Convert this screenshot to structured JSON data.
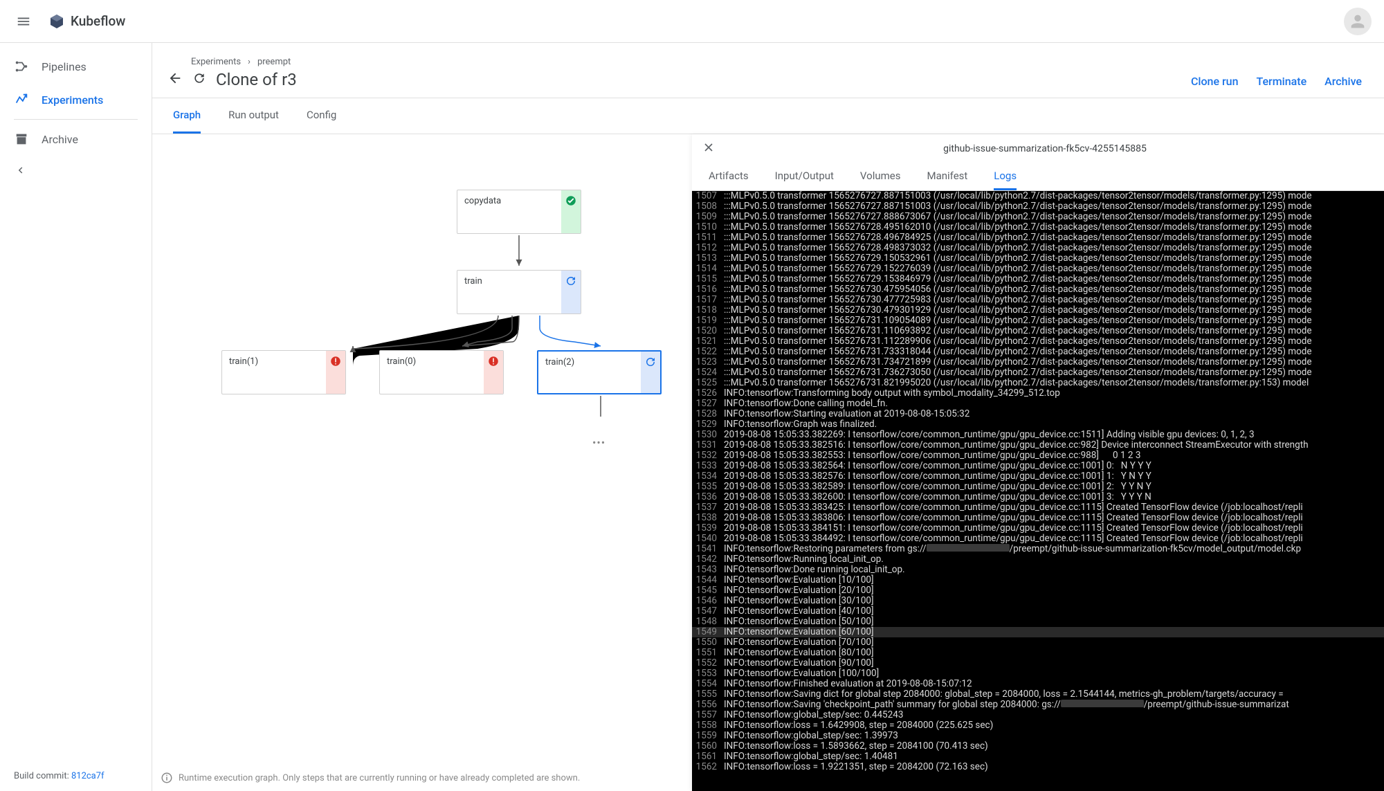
{
  "brand": {
    "name": "Kubeflow"
  },
  "sidebar": {
    "items": [
      {
        "label": "Pipelines"
      },
      {
        "label": "Experiments"
      },
      {
        "label": "Archive"
      }
    ],
    "build_label": "Build commit: ",
    "build_hash": "812ca7f"
  },
  "breadcrumbs": [
    "Experiments",
    "preempt"
  ],
  "page_title": "Clone of r3",
  "head_actions": [
    "Clone run",
    "Terminate",
    "Archive"
  ],
  "tabs": [
    "Graph",
    "Run output",
    "Config"
  ],
  "graph": {
    "nodes": [
      {
        "id": "copydata",
        "label": "copydata",
        "status": "success"
      },
      {
        "id": "train",
        "label": "train",
        "status": "running"
      },
      {
        "id": "train1",
        "label": "train(1)",
        "status": "error"
      },
      {
        "id": "train0",
        "label": "train(0)",
        "status": "error"
      },
      {
        "id": "train2",
        "label": "train(2)",
        "status": "running",
        "selected": true
      }
    ]
  },
  "footer_note": "Runtime execution graph. Only steps that are currently running or have already completed are shown.",
  "side_panel": {
    "title": "github-issue-summarization-fk5cv-4255145885",
    "tabs": [
      "Artifacts",
      "Input/Output",
      "Volumes",
      "Manifest",
      "Logs"
    ],
    "active_tab": "Logs"
  },
  "logs": [
    {
      "n": 1507,
      "t": ":::MLPv0.5.0 transformer 1565276727.887151003 (/usr/local/lib/python2.7/dist-packages/tensor2tensor/models/transformer.py:1295) mode"
    },
    {
      "n": 1508,
      "t": ":::MLPv0.5.0 transformer 1565276727.887151003 (/usr/local/lib/python2.7/dist-packages/tensor2tensor/models/transformer.py:1295) mode"
    },
    {
      "n": 1509,
      "t": ":::MLPv0.5.0 transformer 1565276727.888673067 (/usr/local/lib/python2.7/dist-packages/tensor2tensor/models/transformer.py:1295) mode"
    },
    {
      "n": 1510,
      "t": ":::MLPv0.5.0 transformer 1565276728.495162010 (/usr/local/lib/python2.7/dist-packages/tensor2tensor/models/transformer.py:1295) mode"
    },
    {
      "n": 1511,
      "t": ":::MLPv0.5.0 transformer 1565276728.496784925 (/usr/local/lib/python2.7/dist-packages/tensor2tensor/models/transformer.py:1295) mode"
    },
    {
      "n": 1512,
      "t": ":::MLPv0.5.0 transformer 1565276728.498373032 (/usr/local/lib/python2.7/dist-packages/tensor2tensor/models/transformer.py:1295) mode"
    },
    {
      "n": 1513,
      "t": ":::MLPv0.5.0 transformer 1565276729.150532961 (/usr/local/lib/python2.7/dist-packages/tensor2tensor/models/transformer.py:1295) mode"
    },
    {
      "n": 1514,
      "t": ":::MLPv0.5.0 transformer 1565276729.152276039 (/usr/local/lib/python2.7/dist-packages/tensor2tensor/models/transformer.py:1295) mode"
    },
    {
      "n": 1515,
      "t": ":::MLPv0.5.0 transformer 1565276729.153846979 (/usr/local/lib/python2.7/dist-packages/tensor2tensor/models/transformer.py:1295) mode"
    },
    {
      "n": 1516,
      "t": ":::MLPv0.5.0 transformer 1565276730.475954056 (/usr/local/lib/python2.7/dist-packages/tensor2tensor/models/transformer.py:1295) mode"
    },
    {
      "n": 1517,
      "t": ":::MLPv0.5.0 transformer 1565276730.477725983 (/usr/local/lib/python2.7/dist-packages/tensor2tensor/models/transformer.py:1295) mode"
    },
    {
      "n": 1518,
      "t": ":::MLPv0.5.0 transformer 1565276730.479301929 (/usr/local/lib/python2.7/dist-packages/tensor2tensor/models/transformer.py:1295) mode"
    },
    {
      "n": 1519,
      "t": ":::MLPv0.5.0 transformer 1565276731.109054089 (/usr/local/lib/python2.7/dist-packages/tensor2tensor/models/transformer.py:1295) mode"
    },
    {
      "n": 1520,
      "t": ":::MLPv0.5.0 transformer 1565276731.110693892 (/usr/local/lib/python2.7/dist-packages/tensor2tensor/models/transformer.py:1295) mode"
    },
    {
      "n": 1521,
      "t": ":::MLPv0.5.0 transformer 1565276731.112289906 (/usr/local/lib/python2.7/dist-packages/tensor2tensor/models/transformer.py:1295) mode"
    },
    {
      "n": 1522,
      "t": ":::MLPv0.5.0 transformer 1565276731.733318044 (/usr/local/lib/python2.7/dist-packages/tensor2tensor/models/transformer.py:1295) mode"
    },
    {
      "n": 1523,
      "t": ":::MLPv0.5.0 transformer 1565276731.734721899 (/usr/local/lib/python2.7/dist-packages/tensor2tensor/models/transformer.py:1295) mode"
    },
    {
      "n": 1524,
      "t": ":::MLPv0.5.0 transformer 1565276731.736273050 (/usr/local/lib/python2.7/dist-packages/tensor2tensor/models/transformer.py:1295) mode"
    },
    {
      "n": 1525,
      "t": ":::MLPv0.5.0 transformer 1565276731.821995020 (/usr/local/lib/python2.7/dist-packages/tensor2tensor/models/transformer.py:153) model"
    },
    {
      "n": 1526,
      "t": "INFO:tensorflow:Transforming body output with symbol_modality_34299_512.top"
    },
    {
      "n": 1527,
      "t": "INFO:tensorflow:Done calling model_fn."
    },
    {
      "n": 1528,
      "t": "INFO:tensorflow:Starting evaluation at 2019-08-08-15:05:32"
    },
    {
      "n": 1529,
      "t": "INFO:tensorflow:Graph was finalized."
    },
    {
      "n": 1530,
      "t": "2019-08-08 15:05:33.382269: I tensorflow/core/common_runtime/gpu/gpu_device.cc:1511] Adding visible gpu devices: 0, 1, 2, 3"
    },
    {
      "n": 1531,
      "t": "2019-08-08 15:05:33.382516: I tensorflow/core/common_runtime/gpu/gpu_device.cc:982] Device interconnect StreamExecutor with strength"
    },
    {
      "n": 1532,
      "t": "2019-08-08 15:05:33.382553: I tensorflow/core/common_runtime/gpu/gpu_device.cc:988]      0 1 2 3"
    },
    {
      "n": 1533,
      "t": "2019-08-08 15:05:33.382564: I tensorflow/core/common_runtime/gpu/gpu_device.cc:1001] 0:   N Y Y Y"
    },
    {
      "n": 1534,
      "t": "2019-08-08 15:05:33.382576: I tensorflow/core/common_runtime/gpu/gpu_device.cc:1001] 1:   Y N Y Y"
    },
    {
      "n": 1535,
      "t": "2019-08-08 15:05:33.382589: I tensorflow/core/common_runtime/gpu/gpu_device.cc:1001] 2:   Y Y N Y"
    },
    {
      "n": 1536,
      "t": "2019-08-08 15:05:33.382600: I tensorflow/core/common_runtime/gpu/gpu_device.cc:1001] 3:   Y Y Y N"
    },
    {
      "n": 1537,
      "t": "2019-08-08 15:05:33.383425: I tensorflow/core/common_runtime/gpu/gpu_device.cc:1115] Created TensorFlow device (/job:localhost/repli"
    },
    {
      "n": 1538,
      "t": "2019-08-08 15:05:33.383806: I tensorflow/core/common_runtime/gpu/gpu_device.cc:1115] Created TensorFlow device (/job:localhost/repli"
    },
    {
      "n": 1539,
      "t": "2019-08-08 15:05:33.384151: I tensorflow/core/common_runtime/gpu/gpu_device.cc:1115] Created TensorFlow device (/job:localhost/repli"
    },
    {
      "n": 1540,
      "t": "2019-08-08 15:05:33.384492: I tensorflow/core/common_runtime/gpu/gpu_device.cc:1115] Created TensorFlow device (/job:localhost/repli"
    },
    {
      "n": 1541,
      "t": "INFO:tensorflow:Restoring parameters from gs://",
      "redact": true,
      "t2": "/preempt/github-issue-summarization-fk5cv/model_output/model.ckp"
    },
    {
      "n": 1542,
      "t": "INFO:tensorflow:Running local_init_op."
    },
    {
      "n": 1543,
      "t": "INFO:tensorflow:Done running local_init_op."
    },
    {
      "n": 1544,
      "t": "INFO:tensorflow:Evaluation [10/100]"
    },
    {
      "n": 1545,
      "t": "INFO:tensorflow:Evaluation [20/100]"
    },
    {
      "n": 1546,
      "t": "INFO:tensorflow:Evaluation [30/100]"
    },
    {
      "n": 1547,
      "t": "INFO:tensorflow:Evaluation [40/100]"
    },
    {
      "n": 1548,
      "t": "INFO:tensorflow:Evaluation [50/100]"
    },
    {
      "n": 1549,
      "t": "INFO:tensorflow:Evaluation [60/100]",
      "hl": true
    },
    {
      "n": 1550,
      "t": "INFO:tensorflow:Evaluation [70/100]"
    },
    {
      "n": 1551,
      "t": "INFO:tensorflow:Evaluation [80/100]"
    },
    {
      "n": 1552,
      "t": "INFO:tensorflow:Evaluation [90/100]"
    },
    {
      "n": 1553,
      "t": "INFO:tensorflow:Evaluation [100/100]"
    },
    {
      "n": 1554,
      "t": "INFO:tensorflow:Finished evaluation at 2019-08-08-15:07:12"
    },
    {
      "n": 1555,
      "t": "INFO:tensorflow:Saving dict for global step 2084000: global_step = 2084000, loss = 2.1544144, metrics-gh_problem/targets/accuracy ="
    },
    {
      "n": 1556,
      "t": "INFO:tensorflow:Saving 'checkpoint_path' summary for global step 2084000: gs://",
      "redact": true,
      "t2": "/preempt/github-issue-summarizat"
    },
    {
      "n": 1557,
      "t": "INFO:tensorflow:global_step/sec: 0.445243"
    },
    {
      "n": 1558,
      "t": "INFO:tensorflow:loss = 1.6429908, step = 2084000 (225.625 sec)"
    },
    {
      "n": 1559,
      "t": "INFO:tensorflow:global_step/sec: 1.39973"
    },
    {
      "n": 1560,
      "t": "INFO:tensorflow:loss = 1.5893662, step = 2084100 (70.413 sec)"
    },
    {
      "n": 1561,
      "t": "INFO:tensorflow:global_step/sec: 1.40481"
    },
    {
      "n": 1562,
      "t": "INFO:tensorflow:loss = 1.9221351, step = 2084200 (72.163 sec)"
    }
  ]
}
